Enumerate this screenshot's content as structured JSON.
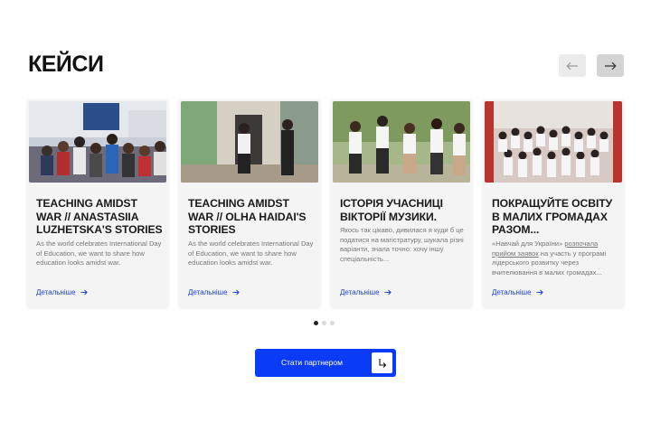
{
  "section": {
    "title": "КЕЙСИ"
  },
  "nav": {
    "prev_icon": "arrow-left-icon",
    "next_icon": "arrow-right-icon"
  },
  "cards": [
    {
      "title": "TEACHING AMIDST WAR // ANASTASIIA LUZHETSKA'S STORIES",
      "description": "As the world celebrates International Day of Education, we want to share how education looks amidst war.",
      "link": "Детальніше"
    },
    {
      "title": "TEACHING AMIDST WAR // OLHA HAIDAI'S STORIES",
      "description": "As the world celebrates International Day of Education, we want to share how education looks amidst war.",
      "link": "Детальніше"
    },
    {
      "title": "ІСТОРІЯ УЧАСНИЦІ ВІКТОРІЇ МУЗИКИ.",
      "description": "Якось так цікаво, дивилася я куди б це податися на магістратуру, шукала різні варіанти, знала точно: хочу іншу спеціальність...",
      "link": "Детальніше"
    },
    {
      "title": "ПОКРАЩУЙТЕ ОСВІТУ В МАЛИХ ГРОМАДАХ РАЗОМ...",
      "description_parts": [
        "«Навчай для України» ",
        "розпочала прийом заявок",
        " на участь у програмі лідерського розвитку через вчителювання в малих громадах..."
      ],
      "link": "Детальніше"
    }
  ],
  "pagination": {
    "total": 3,
    "active": 1
  },
  "cta": {
    "label": "Стати партнером",
    "icon": "arrow-down-right-icon"
  },
  "colors": {
    "accent": "#0A3CF7",
    "link": "#1A3FD6",
    "card_bg": "#F4F4F4"
  }
}
